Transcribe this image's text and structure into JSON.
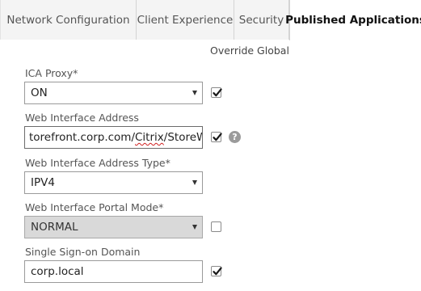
{
  "tabs": [
    {
      "label": "Network Configuration"
    },
    {
      "label": "Client Experience"
    },
    {
      "label": "Security"
    },
    {
      "label": "Published Applications"
    }
  ],
  "override_heading": "Override Global",
  "fields": {
    "ica_proxy": {
      "label": "ICA Proxy*",
      "value": "ON",
      "override_checked": true
    },
    "web_interface_address": {
      "label": "Web Interface Address",
      "value_prefix": "torefront.corp.com/",
      "value_misspelled": "Citrix",
      "value_mid": "/",
      "value_misspelled2": "StoreWeb",
      "override_checked": true,
      "help_icon": "question-mark-icon",
      "help_glyph": "?"
    },
    "web_interface_address_type": {
      "label": "Web Interface Address Type*",
      "value": "IPV4"
    },
    "web_interface_portal_mode": {
      "label": "Web Interface Portal Mode*",
      "value": "NORMAL",
      "override_checked": false
    },
    "single_sign_on_domain": {
      "label": "Single Sign-on Domain",
      "value": "corp.local",
      "override_checked": true
    }
  },
  "colors": {
    "tab_background": "#f4f4f4",
    "active_tab_background": "#ffffff",
    "disabled_field": "#d9d9d9",
    "help_icon": "#9b9b9b"
  }
}
